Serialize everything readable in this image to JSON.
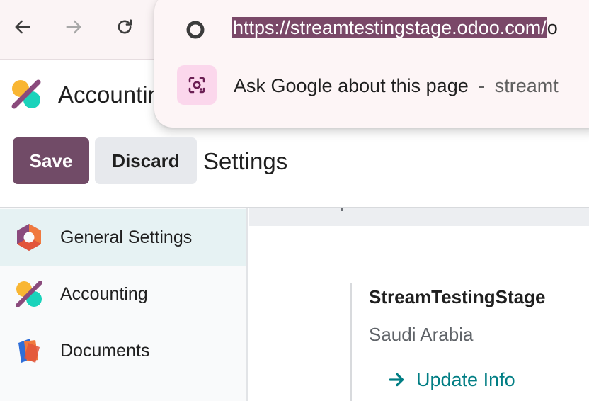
{
  "browser": {
    "back_icon": "arrow-left-icon",
    "forward_icon": "arrow-right-icon",
    "reload_icon": "reload-icon"
  },
  "omnibox": {
    "url_selected": "https://streamtestingstage.odoo.com/",
    "url_rest": "o",
    "suggestion_text": "Ask Google about this page",
    "suggestion_separator": "-",
    "suggestion_domain": "streamt",
    "suggestion_icon": "google-lens-icon"
  },
  "app": {
    "title": "Accountin",
    "logo_icon": "accounting-app-icon"
  },
  "controls": {
    "save_label": "Save",
    "discard_label": "Discard",
    "breadcrumb": "Settings"
  },
  "sidebar": {
    "items": [
      {
        "label": "General Settings",
        "icon": "general-settings-icon",
        "active": true
      },
      {
        "label": "Accounting",
        "icon": "accounting-app-icon",
        "active": false
      },
      {
        "label": "Documents",
        "icon": "documents-app-icon",
        "active": false
      }
    ]
  },
  "company": {
    "name": "StreamTestingStage",
    "country": "Saudi Arabia",
    "update_label": "Update Info"
  },
  "colors": {
    "brand": "#714b67",
    "link": "#017e84",
    "selection": "#7a4868",
    "active_item_bg": "#e6f2f3"
  }
}
